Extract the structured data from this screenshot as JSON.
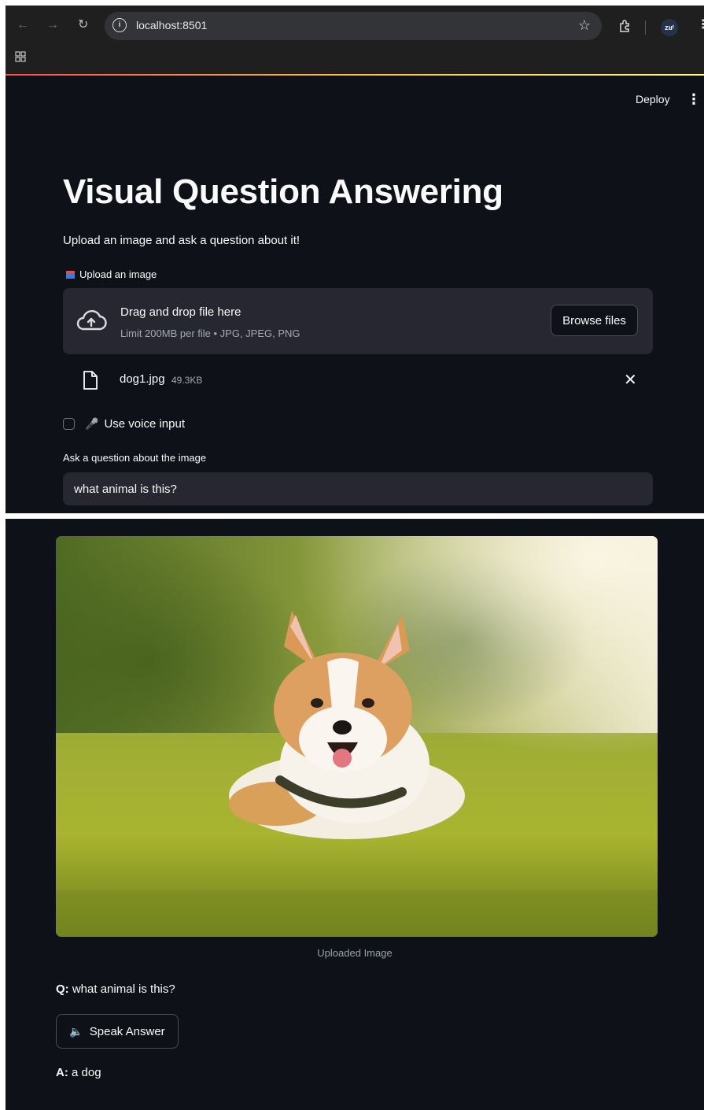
{
  "browser": {
    "url": "localhost:8501",
    "avatar_text": "ᴢᴚᵗ"
  },
  "app": {
    "deploy_label": "Deploy",
    "menu_glyph": "⋮",
    "title": "Visual Question Answering",
    "subtitle": "Upload an image and ask a question about it!"
  },
  "uploader": {
    "label": "Upload an image",
    "drop_title": "Drag and drop file here",
    "drop_limits": "Limit 200MB per file • JPG, JPEG, PNG",
    "browse_label": "Browse files",
    "file": {
      "name": "dog1.jpg",
      "size": "49.3KB"
    }
  },
  "voice": {
    "label": "Use voice input",
    "checked": false
  },
  "question": {
    "label": "Ask a question about the image",
    "value": "what animal is this?"
  },
  "result": {
    "caption": "Uploaded Image",
    "q_prefix": "Q:",
    "q_text": "what animal is this?",
    "speak_label": "Speak Answer",
    "a_prefix": "A:",
    "a_text": "a dog"
  },
  "icons": {
    "back": "back-arrow-icon",
    "forward": "forward-arrow-icon",
    "reload": "reload-icon",
    "site_info": "info-icon",
    "bookmark": "star-icon",
    "extensions": "puzzle-icon",
    "apps": "grid-icon",
    "upload": "inbox-tray-icon",
    "cloud": "cloud-upload-icon",
    "file": "file-icon",
    "remove": "close-icon",
    "mic": "microphone-icon",
    "speaker": "speaker-icon"
  },
  "colors": {
    "background": "#0e1117",
    "panel": "#262730",
    "text": "#fafafa",
    "muted": "#a3a8b4",
    "accent_red": "#ff4b4b"
  }
}
